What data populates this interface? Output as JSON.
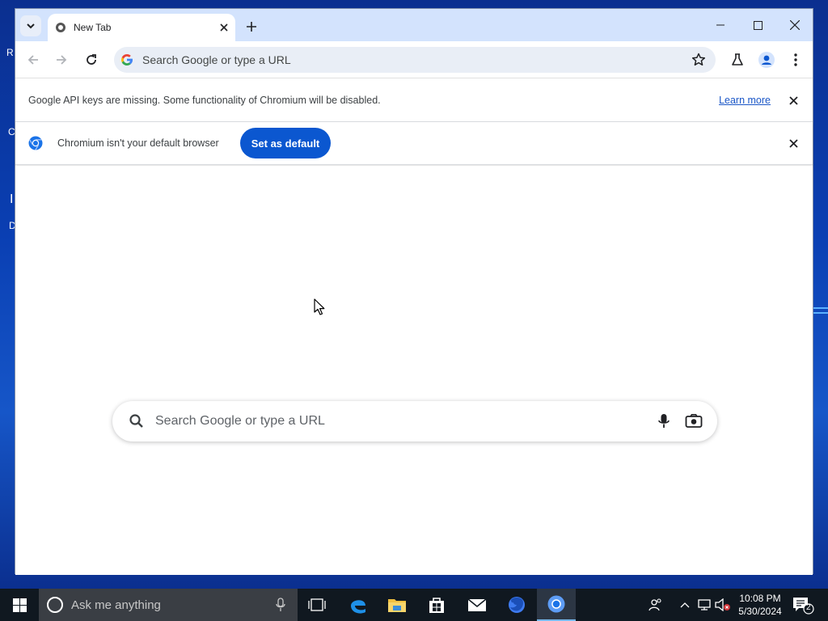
{
  "desktop": {
    "left_glyphs": [
      "R",
      "C",
      "I",
      "D"
    ]
  },
  "browser": {
    "tab": {
      "title": "New Tab"
    },
    "omnibox": {
      "placeholder": "Search Google or type a URL"
    },
    "infobar_api": {
      "message": "Google API keys are missing. Some functionality of Chromium will be disabled.",
      "link": "Learn more"
    },
    "infobar_default": {
      "message": "Chromium isn't your default browser",
      "button": "Set as default"
    },
    "ntp": {
      "search_placeholder": "Search Google or type a URL"
    }
  },
  "taskbar": {
    "search_placeholder": "Ask me anything",
    "clock": {
      "time": "10:08 PM",
      "date": "5/30/2024"
    },
    "notification_count": "2",
    "apps": [
      "task-view",
      "edge",
      "file-explorer",
      "store",
      "mail",
      "firefox",
      "chromium"
    ]
  },
  "colors": {
    "accent": "#0b57d0",
    "tabstrip": "#d3e3fd",
    "taskbar": "#101820",
    "desktop": "#0a3fb3"
  }
}
